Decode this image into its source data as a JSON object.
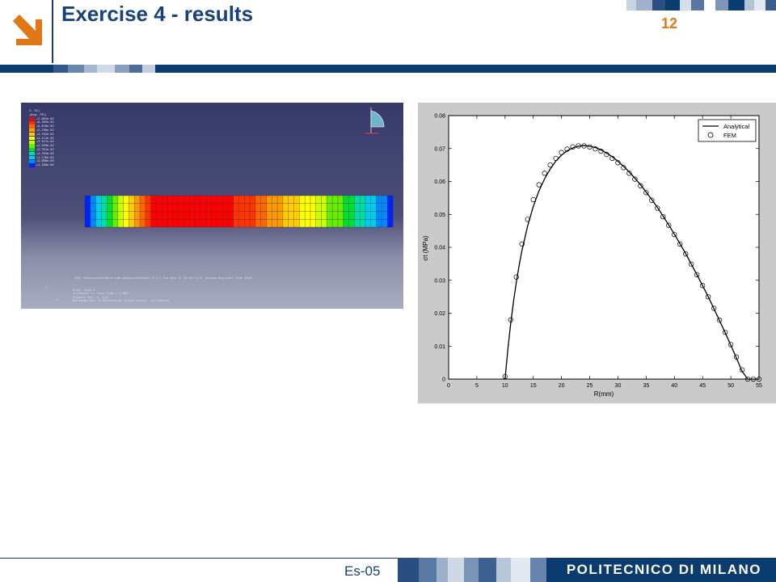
{
  "slide": {
    "title": "Exercise 4 - results",
    "page_number": "12",
    "footer_label": "Es-05",
    "brand": "POLITECNICO DI MILANO",
    "colors": {
      "navy": "#0b3c70",
      "title_blue": "#17427a",
      "orange": "#e07818"
    },
    "logo_icon": "arrow-down-right-icon"
  },
  "fem": {
    "legend": {
      "header": [
        "S, S11",
        "(Avg: 75%)"
      ],
      "values": [
        "+7.063e-02",
        "+6.465e-02",
        "+5.878e-02",
        "+5.290e-02",
        "+4.702e-02",
        "+4.114e-02",
        "+3.527e-02",
        "+2.939e-02",
        "+2.351e-02",
        "+1.763e-02",
        "+1.176e-02",
        "+5.880e-03",
        "+1.268e-06"
      ]
    },
    "info": {
      "odb_line": "ODB: RotatingDiskHole.odb    Abaqus/Standard 6.9-1    Tue May 11 10:54:13 W. Europe Daylight Time 2010",
      "step_lines": [
        "Step: Step-1",
        "Increment    1: Step Time =    1.000",
        "Primary Var: S, S11",
        "Deformed Var: U   Deformation Scale Factor: +2.279e+05"
      ]
    },
    "triad": {
      "y": "Y",
      "x": "X"
    }
  },
  "chart_data": {
    "type": "line",
    "xlabel": "R(mm)",
    "ylabel": "σt (MPa)",
    "xlim": [
      0,
      55
    ],
    "ylim": [
      0,
      0.08
    ],
    "xticks": [
      "0",
      "5",
      "10",
      "15",
      "20",
      "25",
      "30",
      "35",
      "40",
      "45",
      "50",
      "55"
    ],
    "yticks": [
      "0",
      "0.01",
      "0.02",
      "0.03",
      "0.04",
      "0.05",
      "0.06",
      "0.07",
      "0.08"
    ],
    "grid": false,
    "legend_position": "top-right",
    "series": [
      {
        "name": "Analytical",
        "style": "line",
        "x": [
          10,
          10.5,
          11,
          11.5,
          12,
          12.5,
          13,
          14,
          15,
          16,
          17,
          18,
          19,
          20,
          21,
          22,
          23,
          24,
          25,
          26,
          27,
          28,
          29,
          30,
          31,
          32,
          33,
          34,
          35,
          36,
          37,
          38,
          39,
          40,
          41,
          42,
          43,
          44,
          45,
          46,
          47,
          48,
          49,
          50,
          51,
          52,
          53,
          54,
          55
        ],
        "y": [
          0,
          0.0091,
          0.0169,
          0.0236,
          0.0294,
          0.0346,
          0.0391,
          0.0465,
          0.0524,
          0.0571,
          0.0608,
          0.0638,
          0.0662,
          0.068,
          0.0693,
          0.0702,
          0.0707,
          0.0709,
          0.0707,
          0.0703,
          0.0696,
          0.0686,
          0.0675,
          0.0661,
          0.0646,
          0.0629,
          0.061,
          0.059,
          0.0568,
          0.0545,
          0.0521,
          0.0495,
          0.0468,
          0.044,
          0.0411,
          0.0381,
          0.0349,
          0.0317,
          0.0284,
          0.025,
          0.0214,
          0.0178,
          0.0141,
          0.0103,
          0.0064,
          0.0024,
          0.0,
          0.0,
          0.0
        ]
      },
      {
        "name": "FEM",
        "style": "circle",
        "x": [
          10,
          11,
          12,
          13,
          14,
          15,
          16,
          17,
          18,
          19,
          20,
          21,
          22,
          23,
          24,
          25,
          26,
          27,
          28,
          29,
          30,
          31,
          32,
          33,
          34,
          35,
          36,
          37,
          38,
          39,
          40,
          41,
          42,
          43,
          44,
          45,
          46,
          47,
          48,
          49,
          50,
          51,
          52,
          53,
          54,
          55
        ],
        "y": [
          0.0008,
          0.018,
          0.031,
          0.041,
          0.0485,
          0.0545,
          0.059,
          0.0625,
          0.065,
          0.067,
          0.0688,
          0.0698,
          0.0705,
          0.0708,
          0.0708,
          0.0705,
          0.0699,
          0.0692,
          0.0682,
          0.067,
          0.0657,
          0.0642,
          0.0625,
          0.0607,
          0.0587,
          0.0566,
          0.0543,
          0.0519,
          0.0493,
          0.0467,
          0.0439,
          0.041,
          0.038,
          0.0349,
          0.0317,
          0.0284,
          0.025,
          0.0215,
          0.0179,
          0.0142,
          0.0105,
          0.0067,
          0.0028,
          0.0,
          0.0,
          0.0
        ]
      }
    ]
  }
}
